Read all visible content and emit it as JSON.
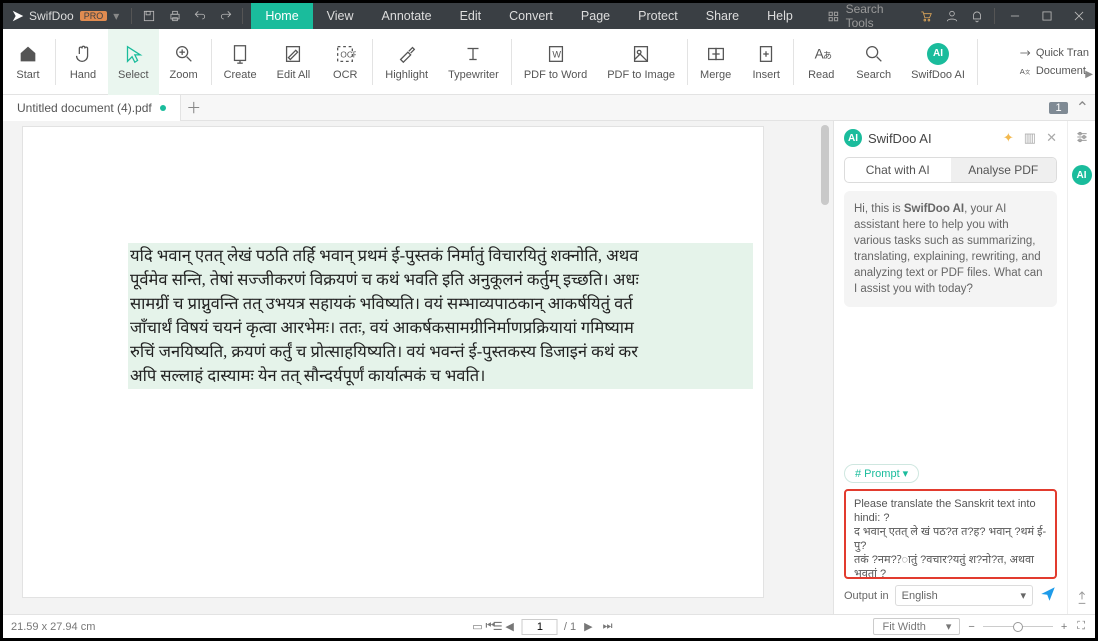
{
  "app": {
    "name": "SwifDoo",
    "badge": "PRO"
  },
  "menus": [
    "Home",
    "View",
    "Annotate",
    "Edit",
    "Convert",
    "Page",
    "Protect",
    "Share",
    "Help"
  ],
  "activeMenu": 0,
  "searchTools": "Search Tools",
  "ribbon": {
    "items": [
      "Start",
      "Hand",
      "Select",
      "Zoom",
      "Create",
      "Edit All",
      "OCR",
      "Highlight",
      "Typewriter",
      "PDF to Word",
      "PDF to Image",
      "Merge",
      "Insert",
      "Read",
      "Search",
      "SwifDoo AI"
    ],
    "right": [
      "Quick Tran",
      "Document"
    ]
  },
  "tab": {
    "name": "Untitled document (4).pdf"
  },
  "pageBadge": "1",
  "docText": "यदि भवान् एतत् लेखं पठति तर्हि भवान् प्रथमं ई-पुस्तकं निर्मातुं विचारयितुं शक्नोति, अथव\nपूर्वमेव सन्ति, तेषां सज्जीकरणं विक्रयणं च कथं भवति इति अनुकूलनं कर्तुम् इच्छति। अधः\nसामग्रीं च प्राप्नुवन्ति तत् उभयत्र सहायकं भविष्यति। वयं सम्भाव्यपाठकान् आकर्षयितुं वर्त\nजाँचार्थं विषयं चयनं कृत्वा आरभेमः। ततः, वयं आकर्षकसामग्रीनिर्माणप्रक्रियायां गमिष्याम\nरुचिं जनयिष्यति, क्रयणं कर्तुं च प्रोत्साहयिष्यति। वयं भवन्तं ई-पुस्तकस्य डिजाइनं कथं कर\nअपि सल्लाहं दास्यामः येन तत् सौन्दर्यपूर्णं कार्यात्मकं च भवति।",
  "ai": {
    "title": "SwifDoo AI",
    "tabs": [
      "Chat with AI",
      "Analyse PDF"
    ],
    "greetPrefix": "Hi, this is ",
    "greetBold": "SwifDoo AI",
    "greetRest": ", your AI assistant here to help you with various tasks such as summarizing, translating, explaining, rewriting, and analyzing text or PDF files. What can I assist you with today?",
    "promptChip": "# Prompt  ▾",
    "inputText": "Please translate the Sanskrit text into hindi: ?\nद भवान् एतत् ले खं पठ?त त?ह? भवान् ?थमं ई-पु?\nतकं ?नम??ातुं ?वचार?यतुं श?नो?त, अथवा भवतां ?\nकाशना?न\nपूव? मे व स!?त, तेषां स?जीकरणं ?व?यणं च कथं",
    "outputLabel": "Output in",
    "language": "English"
  },
  "status": {
    "dims": "21.59 x 27.94 cm",
    "page": "1",
    "total": "/ 1",
    "fit": "Fit Width"
  }
}
